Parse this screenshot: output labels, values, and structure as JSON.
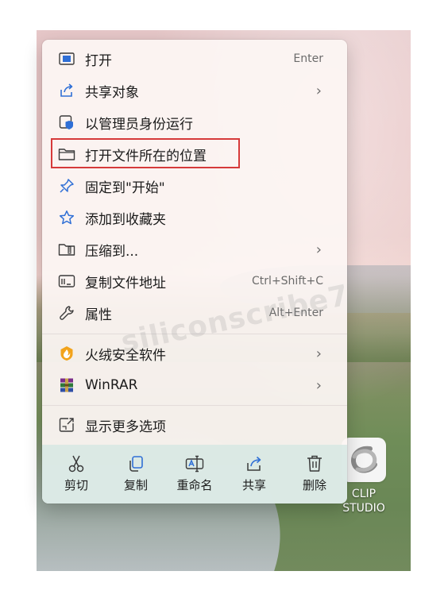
{
  "menu": {
    "items": [
      {
        "label": "打开",
        "shortcut": "Enter",
        "icon": "open-icon"
      },
      {
        "label": "共享对象",
        "submenu": true,
        "icon": "share-icon"
      },
      {
        "label": "以管理员身份运行",
        "icon": "shield-run-icon"
      },
      {
        "label": "打开文件所在的位置",
        "icon": "folder-icon",
        "highlighted": true
      },
      {
        "label": "固定到\"开始\"",
        "icon": "pin-icon"
      },
      {
        "label": "添加到收藏夹",
        "icon": "star-icon"
      },
      {
        "label": "压缩到...",
        "submenu": true,
        "icon": "zip-icon"
      },
      {
        "label": "复制文件地址",
        "shortcut": "Ctrl+Shift+C",
        "icon": "copy-path-icon"
      },
      {
        "label": "属性",
        "shortcut": "Alt+Enter",
        "icon": "wrench-icon"
      },
      {
        "label": "火绒安全软件",
        "submenu": true,
        "icon": "huorong-icon"
      },
      {
        "label": "WinRAR",
        "submenu": true,
        "icon": "winrar-icon"
      },
      {
        "label": "显示更多选项",
        "icon": "more-options-icon"
      }
    ],
    "chevron": "›",
    "highlight_color": "#d63a3a"
  },
  "actions": [
    {
      "label": "剪切",
      "icon": "cut-icon"
    },
    {
      "label": "复制",
      "icon": "copy-icon"
    },
    {
      "label": "重命名",
      "icon": "rename-icon"
    },
    {
      "label": "共享",
      "icon": "share-icon"
    },
    {
      "label": "删除",
      "icon": "delete-icon"
    }
  ],
  "desktop_icon": {
    "label": "CLIP\nSTUDIO",
    "icon": "clip-studio-icon"
  },
  "watermark": "siliconscribe7"
}
